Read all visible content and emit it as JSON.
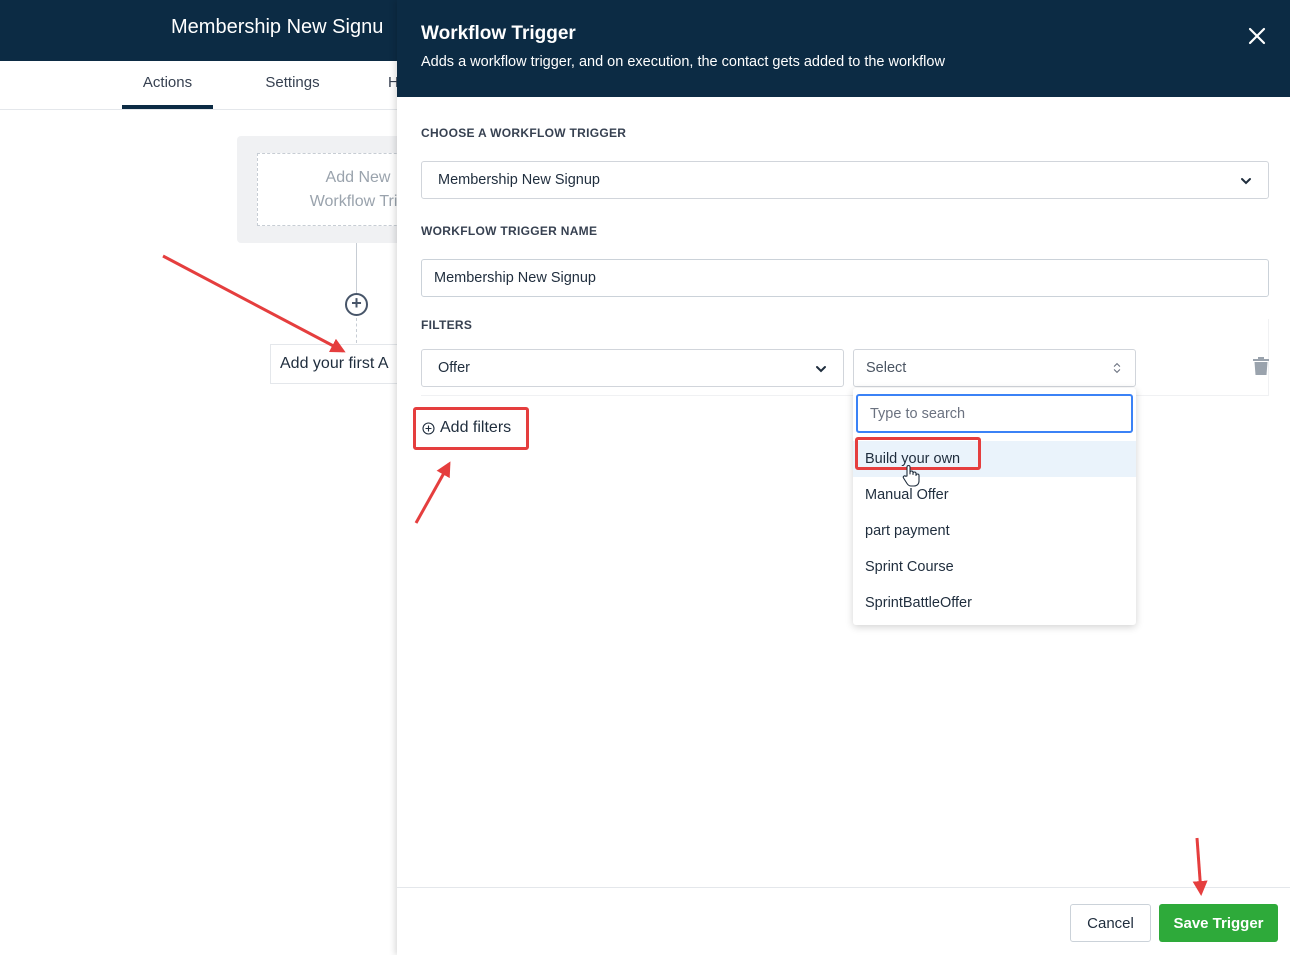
{
  "background": {
    "title": "Membership New Signu",
    "tabs": [
      {
        "label": "Actions",
        "active": true
      },
      {
        "label": "Settings",
        "active": false
      },
      {
        "label": "H",
        "active": false
      }
    ],
    "trigger_card_line1": "Add New",
    "trigger_card_line2": "Workflow Trig",
    "action_placeholder": "Add your first A"
  },
  "drawer": {
    "title": "Workflow Trigger",
    "subtitle": "Adds a workflow trigger, and on execution, the contact gets added to the workflow",
    "trigger_section_label": "CHOOSE A WORKFLOW TRIGGER",
    "trigger_selected": "Membership New Signup",
    "name_section_label": "WORKFLOW TRIGGER NAME",
    "name_value": "Membership New Signup",
    "filters_section_label": "FILTERS",
    "filter_field_value": "Offer",
    "filter_value_placeholder": "Select",
    "add_filters_label": "Add filters",
    "dropdown": {
      "search_placeholder": "Type to search",
      "options": [
        "Build your own",
        "Manual Offer",
        "part payment",
        "Sprint Course",
        "SprintBattleOffer"
      ]
    },
    "cancel_label": "Cancel",
    "save_label": "Save Trigger"
  },
  "colors": {
    "header_bg": "#0c2b44",
    "save_green": "#2eaa3a",
    "annotation_red": "#e53e3e",
    "focus_blue": "#3b82f6"
  },
  "icons": [
    "close-icon",
    "chevron-down-icon",
    "up-down-chevron-icon",
    "trash-icon",
    "plus-circle-icon",
    "hand-cursor-icon"
  ]
}
